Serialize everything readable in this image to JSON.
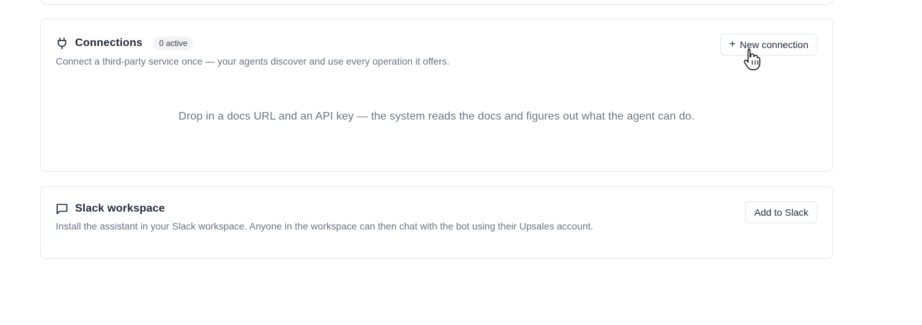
{
  "connections": {
    "title": "Connections",
    "badge": "0 active",
    "description": "Connect a third-party service once — your agents discover and use every operation it offers.",
    "new_button_label": "New connection",
    "empty_state": "Drop in a docs URL and an API key — the system reads the docs and figures out what the agent can do.",
    "icon": "plug-icon"
  },
  "slack": {
    "title": "Slack workspace",
    "description": "Install the assistant in your Slack workspace. Anyone in the workspace can then chat with the bot using their Upsales account.",
    "button_label": "Add to Slack",
    "icon": "message-square-icon"
  },
  "cursor": {
    "type": "pointer-hand"
  }
}
